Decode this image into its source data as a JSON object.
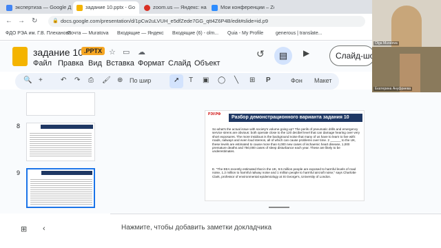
{
  "browser": {
    "tabs": [
      {
        "label": "экспертиза — Google Д",
        "color": "#4285f4"
      },
      {
        "label": "задание 10.pptx - Go",
        "color": "#f4b400"
      },
      {
        "label": "zoom.us — Яндекс: наш",
        "color": "#d93025"
      },
      {
        "label": "Мои конференции – Zoo",
        "color": "#2d8cff"
      }
    ],
    "url": "docs.google.com/presentation/d/1pCw2uLVUH_e5dfZede7GG_qtt4Z6P4B/edit#slide=id.p9",
    "bookmarks": [
      "ФДО РЭА им. Г.В. Плеханова",
      "Почта — Muratova",
      "Входящие — Яндекс",
      "Входящие (6) - olm...",
      "Quia - My Profile",
      "generous | translate..."
    ]
  },
  "doc": {
    "title": "задание 10",
    "badge": ".PPTX",
    "menu": [
      "Файл",
      "Правка",
      "Вид",
      "Вставка",
      "Формат",
      "Слайд",
      "Объект"
    ],
    "slideshow_button": "Слайд-шоу",
    "toolbar": {
      "fit": "По шир",
      "bg": "Фон",
      "layout": "Макет"
    }
  },
  "filmstrip": {
    "numbers": [
      "8",
      "9"
    ]
  },
  "slide": {
    "logo": "РЭУ.РФ",
    "header": "Разбор демонстрационного варианта задания 10",
    "para1": "So what's the actual issue with society's volume going up? The perils of pneumatic drills and emergency service sirens are obvious: both operate close to the 120 decibel level that can damage hearing over very short exposures. The more insidious is the background noise that many of us have to learn to live with: roads, railways and even loud stereos, all of which can cause problems over time. 2 ______ to the UK, these levels are estimated to cause more than 6,000 new cases of ischaemic heart disease, 1,000 premature deaths and 750,000 cases of sleep disturbance each year. These are likely to be underestimates.",
    "para2": "E. \"The EEA recently estimated that in the UK, 9.5 million people are exposed to harmful levels of road noise, 1.2 million to harmful railway noise and 1 million people to harmful aircraft noise,\" says Charlotte Clark, professor of environmental epidemiology at St George's, University of London."
  },
  "notes": {
    "placeholder": "Нажмите, чтобы добавить заметки докладчика"
  },
  "video": {
    "person1": "Olga Muratova",
    "person2": "Екатерина Ануфриева"
  }
}
